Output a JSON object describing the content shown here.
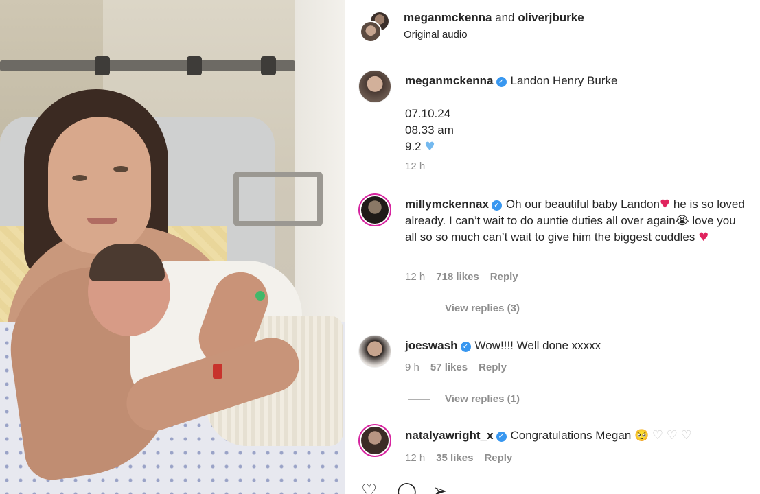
{
  "header": {
    "user1": "meganmckenna",
    "joiner": " and ",
    "user2": "oliverjburke",
    "audio": "Original audio"
  },
  "caption": {
    "user": "meganmckenna",
    "text": "Landon Henry Burke",
    "line1": "07.10.24",
    "line2": "08.33 am",
    "line3": "9.2",
    "time": "12 h"
  },
  "comments": [
    {
      "user": "millymckennax",
      "text_part1": "Oh our beautiful baby Landon",
      "text_part2": " he is so loved already. I can’t wait to do auntie duties all over again",
      "text_part3": " love you all so so much can’t wait to give him the biggest cuddles",
      "time": "12 h",
      "likes": "718 likes",
      "reply": "Reply",
      "view_replies": "View replies (3)"
    },
    {
      "user": "joeswash",
      "text": "Wow!!!! Well done xxxxx",
      "time": "9 h",
      "likes": "57 likes",
      "reply": "Reply",
      "view_replies": "View replies (1)"
    },
    {
      "user": "natalyawright_x",
      "text": "Congratulations Megan",
      "time": "12 h",
      "likes": "35 likes",
      "reply": "Reply"
    }
  ],
  "icons": {
    "verified": "verified-badge-icon",
    "heart": "heart-icon",
    "comment": "comment-icon",
    "share": "share-icon"
  },
  "colors": {
    "verified": "#3897f0",
    "heart": "#e0245e",
    "muted": "#8e8e8e",
    "story_ring": "#d6249f"
  }
}
